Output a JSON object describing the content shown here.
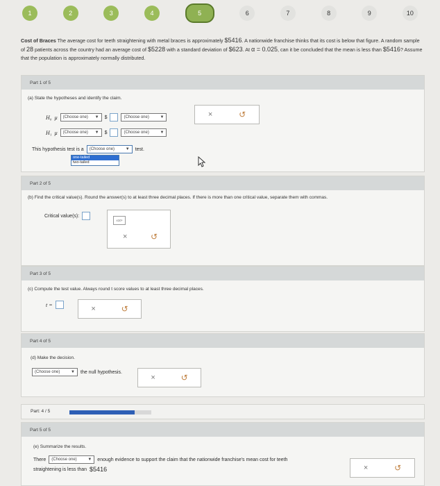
{
  "steps": [
    "1",
    "2",
    "3",
    "4",
    "5",
    "6",
    "7",
    "8",
    "9",
    "10"
  ],
  "problem": {
    "title": "Cost of Braces",
    "text1": "The average cost for teeth straightening with metal braces is approximately",
    "mu": "$5416",
    "text2": ". A nationwide franchise thinks that its cost is below that figure. A random sample of",
    "n": "28",
    "text3": "patients across the country had an average cost of",
    "xbar": "$5228",
    "text4": "with a standard deviation of",
    "s": "$623",
    "text5": ". At",
    "alpha": "α = 0.025",
    "text6": ", can it be concluded that the mean is less than",
    "mu2": "$5416",
    "text7": "? Assume that the population is approximately normally distributed."
  },
  "part1": {
    "header": "Part 1 of 5",
    "question": "(a) State the hypotheses and identify the claim.",
    "h0": "H₀",
    "h1": "H₁",
    "mu_sym": "μ",
    "choose": "(Choose one)",
    "dollar": "$",
    "test_prefix": "This hypothesis test is a",
    "test_suffix": "test.",
    "options": [
      "one-tailed",
      "two-tailed"
    ]
  },
  "part2": {
    "header": "Part 2 of 5",
    "question": "(b) Find the critical value(s). Round the answer(s) to at least three decimal places. If there is more than one critical value, separate them with commas.",
    "label": "Critical value(s):"
  },
  "part3": {
    "header": "Part 3 of 5",
    "question": "(c) Compute the test value. Always round t score values to at least three decimal places.",
    "label": "t ="
  },
  "part4": {
    "header": "Part 4 of 5",
    "question": "(d) Make the decision.",
    "choose": "(Choose one)",
    "suffix": "the null hypothesis."
  },
  "progress": {
    "label": "Part: 4 / 5",
    "fraction": 0.8
  },
  "part5": {
    "header": "Part 5 of 5",
    "question": "(e) Summarize the results.",
    "prefix": "There",
    "choose": "(Choose one)",
    "suffix": "enough evidence to support the claim that the nationwide franchise's mean cost for teeth",
    "line2": "straightening is less than",
    "value": "$5416"
  },
  "actions": {
    "clear": "×",
    "undo": "↺"
  },
  "template_icon": "x10ⁿ"
}
